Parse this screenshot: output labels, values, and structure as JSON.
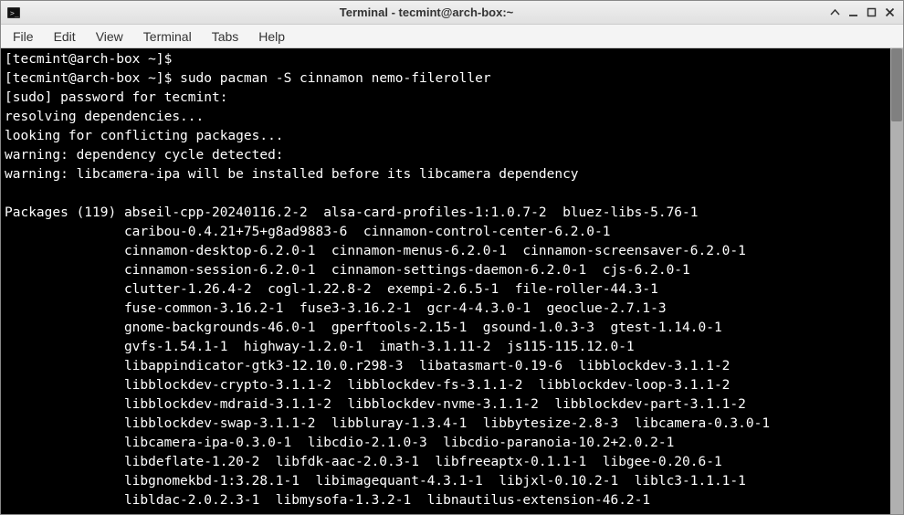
{
  "window": {
    "title": "Terminal - tecmint@arch-box:~"
  },
  "menubar": {
    "items": [
      "File",
      "Edit",
      "View",
      "Terminal",
      "Tabs",
      "Help"
    ]
  },
  "terminal": {
    "prompt_open": "[",
    "prompt_user": "tecmint@arch-box",
    "prompt_path": " ~",
    "prompt_close": "]$",
    "lines": [
      {
        "t": "prompt",
        "cmd": ""
      },
      {
        "t": "prompt",
        "cmd": "sudo pacman -S cinnamon nemo-fileroller"
      },
      {
        "t": "text",
        "v": "[sudo] password for tecmint:"
      },
      {
        "t": "text",
        "v": "resolving dependencies..."
      },
      {
        "t": "text",
        "v": "looking for conflicting packages..."
      },
      {
        "t": "text",
        "v": "warning: dependency cycle detected:"
      },
      {
        "t": "text",
        "v": "warning: libcamera-ipa will be installed before its libcamera dependency"
      },
      {
        "t": "text",
        "v": ""
      },
      {
        "t": "text",
        "v": "Packages (119) abseil-cpp-20240116.2-2  alsa-card-profiles-1:1.0.7-2  bluez-libs-5.76-1"
      },
      {
        "t": "text",
        "v": "               caribou-0.4.21+75+g8ad9883-6  cinnamon-control-center-6.2.0-1"
      },
      {
        "t": "text",
        "v": "               cinnamon-desktop-6.2.0-1  cinnamon-menus-6.2.0-1  cinnamon-screensaver-6.2.0-1"
      },
      {
        "t": "text",
        "v": "               cinnamon-session-6.2.0-1  cinnamon-settings-daemon-6.2.0-1  cjs-6.2.0-1"
      },
      {
        "t": "text",
        "v": "               clutter-1.26.4-2  cogl-1.22.8-2  exempi-2.6.5-1  file-roller-44.3-1"
      },
      {
        "t": "text",
        "v": "               fuse-common-3.16.2-1  fuse3-3.16.2-1  gcr-4-4.3.0-1  geoclue-2.7.1-3"
      },
      {
        "t": "text",
        "v": "               gnome-backgrounds-46.0-1  gperftools-2.15-1  gsound-1.0.3-3  gtest-1.14.0-1"
      },
      {
        "t": "text",
        "v": "               gvfs-1.54.1-1  highway-1.2.0-1  imath-3.1.11-2  js115-115.12.0-1"
      },
      {
        "t": "text",
        "v": "               libappindicator-gtk3-12.10.0.r298-3  libatasmart-0.19-6  libblockdev-3.1.1-2"
      },
      {
        "t": "text",
        "v": "               libblockdev-crypto-3.1.1-2  libblockdev-fs-3.1.1-2  libblockdev-loop-3.1.1-2"
      },
      {
        "t": "text",
        "v": "               libblockdev-mdraid-3.1.1-2  libblockdev-nvme-3.1.1-2  libblockdev-part-3.1.1-2"
      },
      {
        "t": "text",
        "v": "               libblockdev-swap-3.1.1-2  libbluray-1.3.4-1  libbytesize-2.8-3  libcamera-0.3.0-1"
      },
      {
        "t": "text",
        "v": "               libcamera-ipa-0.3.0-1  libcdio-2.1.0-3  libcdio-paranoia-10.2+2.0.2-1"
      },
      {
        "t": "text",
        "v": "               libdeflate-1.20-2  libfdk-aac-2.0.3-1  libfreeaptx-0.1.1-1  libgee-0.20.6-1"
      },
      {
        "t": "text",
        "v": "               libgnomekbd-1:3.28.1-1  libimagequant-4.3.1-1  libjxl-0.10.2-1  liblc3-1.1.1-1"
      },
      {
        "t": "text",
        "v": "               libldac-2.0.2.3-1  libmysofa-1.3.2-1  libnautilus-extension-46.2-1"
      }
    ]
  }
}
